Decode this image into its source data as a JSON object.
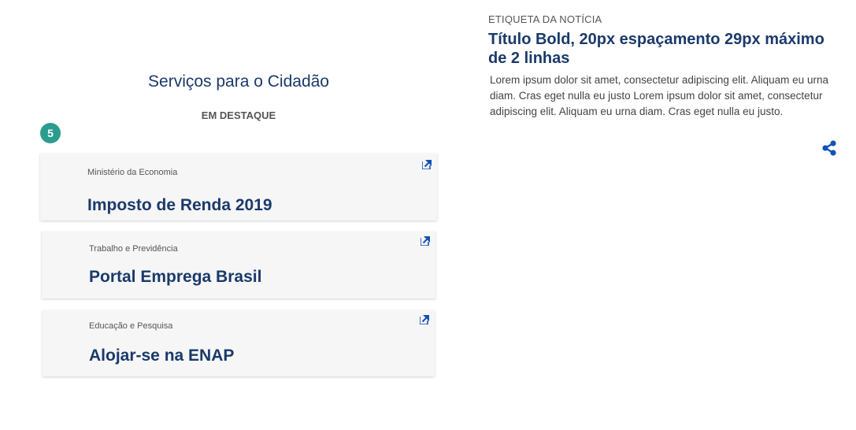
{
  "services": {
    "title": "Serviços para o Cidadão",
    "subtitle": "EM DESTAQUE",
    "badge_count": "5",
    "cards": [
      {
        "agency": "Ministério da Economia",
        "service": "Imposto de Renda 2019",
        "icon": "external-link-icon"
      },
      {
        "agency": "Trabalho e Previdência",
        "service": "Portal Emprega Brasil",
        "icon": "external-link-icon"
      },
      {
        "agency": "Educação e Pesquisa",
        "service": "Alojar-se na ENAP",
        "icon": "external-link-icon"
      }
    ]
  },
  "news": {
    "label": "ETIQUETA DA NOTÍCIA",
    "title": "Título Bold, 20px espaçamento 29px máximo de 2 linhas",
    "body": "Lorem ipsum dolor sit amet, consectetur adipiscing elit. Aliquam eu urna diam. Cras eget nulla eu justo Lorem ipsum dolor sit amet, consectetur adipiscing elit. Aliquam eu urna diam. Cras eget nulla eu justo.",
    "share_icon": "share-icon"
  },
  "colors": {
    "primary": "#1a3a6b",
    "accent": "#1351b4",
    "badge": "#2a9d8f",
    "card_bg": "#f6f6f6"
  }
}
